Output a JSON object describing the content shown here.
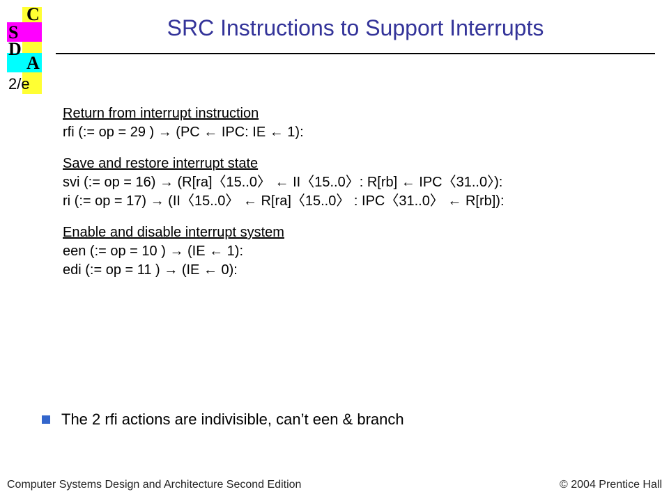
{
  "logo": {
    "c": "C",
    "s": "S",
    "d": "D",
    "a": "A",
    "edition": "2/e"
  },
  "title": "SRC Instructions to Support Interrupts",
  "sections": {
    "s1_head": "Return from interrupt instruction",
    "s1_l1": "rfi (:= op = 29 ) → (PC ← IPC: IE ← 1):",
    "s2_head": "Save and restore interrupt state",
    "s2_l1": "svi (:= op = 16) → (R[ra]〈15..0〉 ← II〈15..0〉: R[rb] ← IPC〈31..0〉):",
    "s2_l2": "ri (:= op = 17) → (II〈15..0〉 ← R[ra]〈15..0〉 : IPC〈31..0〉 ← R[rb]):",
    "s3_head": "Enable and disable interrupt system",
    "s3_l1": "een (:= op = 10 ) → (IE ← 1):",
    "s3_l2": "edi (:= op = 11 ) → (IE ← 0):"
  },
  "bullet": "The 2 rfi actions are indivisible, can’t een & branch",
  "footer": {
    "left": "Computer Systems Design and Architecture Second Edition",
    "right": "© 2004 Prentice Hall"
  }
}
